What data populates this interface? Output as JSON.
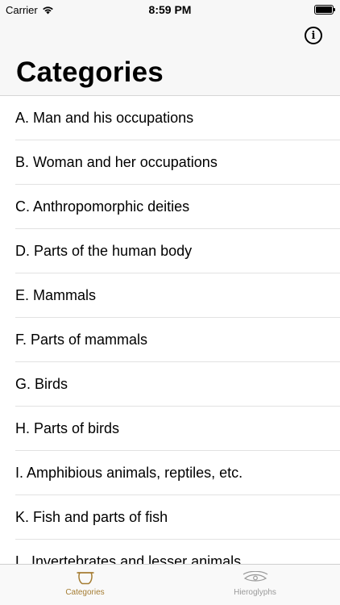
{
  "status_bar": {
    "carrier": "Carrier",
    "time": "8:59 PM"
  },
  "header": {
    "title": "Categories",
    "info_icon": "info-circle-icon"
  },
  "categories": [
    "A. Man and his occupations",
    "B. Woman and her occupations",
    "C. Anthropomorphic deities",
    "D. Parts of the human body",
    "E. Mammals",
    "F. Parts of mammals",
    "G. Birds",
    "H. Parts of birds",
    "I. Amphibious animals, reptiles, etc.",
    "K. Fish and parts of fish",
    "L. Invertebrates and lesser animals"
  ],
  "tab_bar": {
    "tabs": [
      {
        "label": "Categories",
        "icon": "pot-icon",
        "active": true
      },
      {
        "label": "Hieroglyphs",
        "icon": "eye-hieroglyph-icon",
        "active": false
      }
    ]
  },
  "colors": {
    "accent": "#a57d33",
    "inactive": "#9a9a9a",
    "bar_background": "#f7f7f7"
  }
}
